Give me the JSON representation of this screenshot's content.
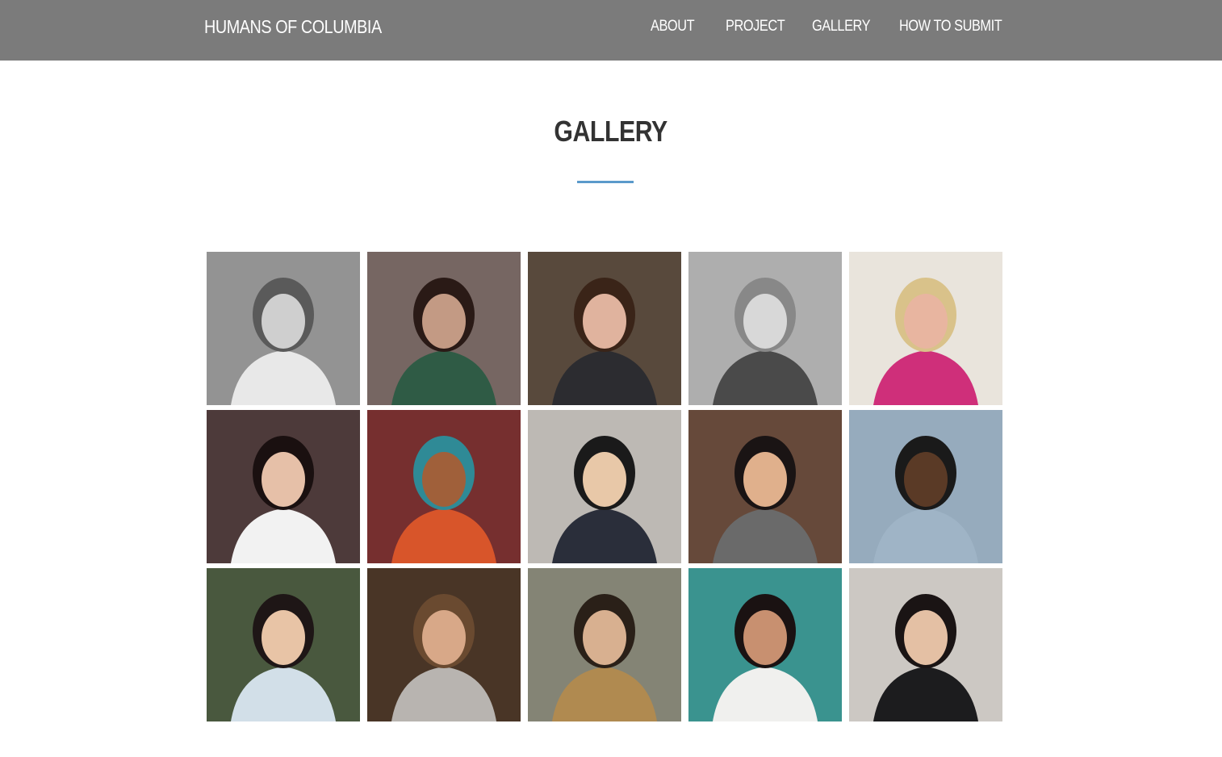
{
  "header": {
    "brand": "HUMANS OF COLUMBIA",
    "nav": {
      "about": "ABOUT",
      "project": "PROJECT",
      "gallery": "GALLERY",
      "submit": "HOW TO SUBMIT"
    }
  },
  "main": {
    "title": "GALLERY",
    "accent_color": "#5b9acb"
  },
  "gallery": {
    "photos": [
      {
        "subject": "woman-stairs-bw",
        "bg": "#8a8a8a",
        "fg": "#cfcfcf",
        "hair": "#5a5a5a",
        "top": "#e8e8e8"
      },
      {
        "subject": "woman-reading-book",
        "bg": "#6b5a55",
        "fg": "#c39a84",
        "hair": "#2a1a16",
        "top": "#2f5b45"
      },
      {
        "subject": "woman-in-grass",
        "bg": "#4a3a2c",
        "fg": "#e0b39e",
        "hair": "#3a2418",
        "top": "#2c2c30"
      },
      {
        "subject": "dancer-street-bw",
        "bg": "#a8a8a8",
        "fg": "#d8d8d8",
        "hair": "#888888",
        "top": "#4a4a4a"
      },
      {
        "subject": "woman-pink-jacket",
        "bg": "#e8e2da",
        "fg": "#e8b5a0",
        "hair": "#d9c28a",
        "top": "#cf2f7a"
      },
      {
        "subject": "woman-library-shelves",
        "bg": "#3e2a2a",
        "fg": "#e6c0a8",
        "hair": "#1a1010",
        "top": "#f2f2f2"
      },
      {
        "subject": "dancer-turban",
        "bg": "#6b1e1e",
        "fg": "#a0603a",
        "hair": "#2f8a96",
        "top": "#d8552a"
      },
      {
        "subject": "man-coffee-suit",
        "bg": "#b8b4ae",
        "fg": "#e8c8a8",
        "hair": "#1a1a1a",
        "top": "#2a2e3a"
      },
      {
        "subject": "woman-smiling-sweater",
        "bg": "#5a3a2a",
        "fg": "#e0b08c",
        "hair": "#1a1414",
        "top": "#6a6a6a"
      },
      {
        "subject": "man-yoga-rooftop",
        "bg": "#8ea4b8",
        "fg": "#5a3a26",
        "hair": "#1a1a1a",
        "top": "#9fb4c6"
      },
      {
        "subject": "woman-folder-campus",
        "bg": "#3a4a2e",
        "fg": "#e8c4a6",
        "hair": "#1e1616",
        "top": "#d2dfe8"
      },
      {
        "subject": "man-dark-portrait",
        "bg": "#3a2414",
        "fg": "#d8a888",
        "hair": "#6a4a30",
        "top": "#b8b4b0"
      },
      {
        "subject": "group-jumping-street",
        "bg": "#7a7a6a",
        "fg": "#d8b090",
        "hair": "#2a2018",
        "top": "#b08a50"
      },
      {
        "subject": "woman-white-blouse",
        "bg": "#2a8a86",
        "fg": "#c89070",
        "hair": "#1a1212",
        "top": "#f0f0ee"
      },
      {
        "subject": "man-black-coat",
        "bg": "#c8c4be",
        "fg": "#e4c0a4",
        "hair": "#1a1414",
        "top": "#1c1c1e"
      }
    ]
  }
}
